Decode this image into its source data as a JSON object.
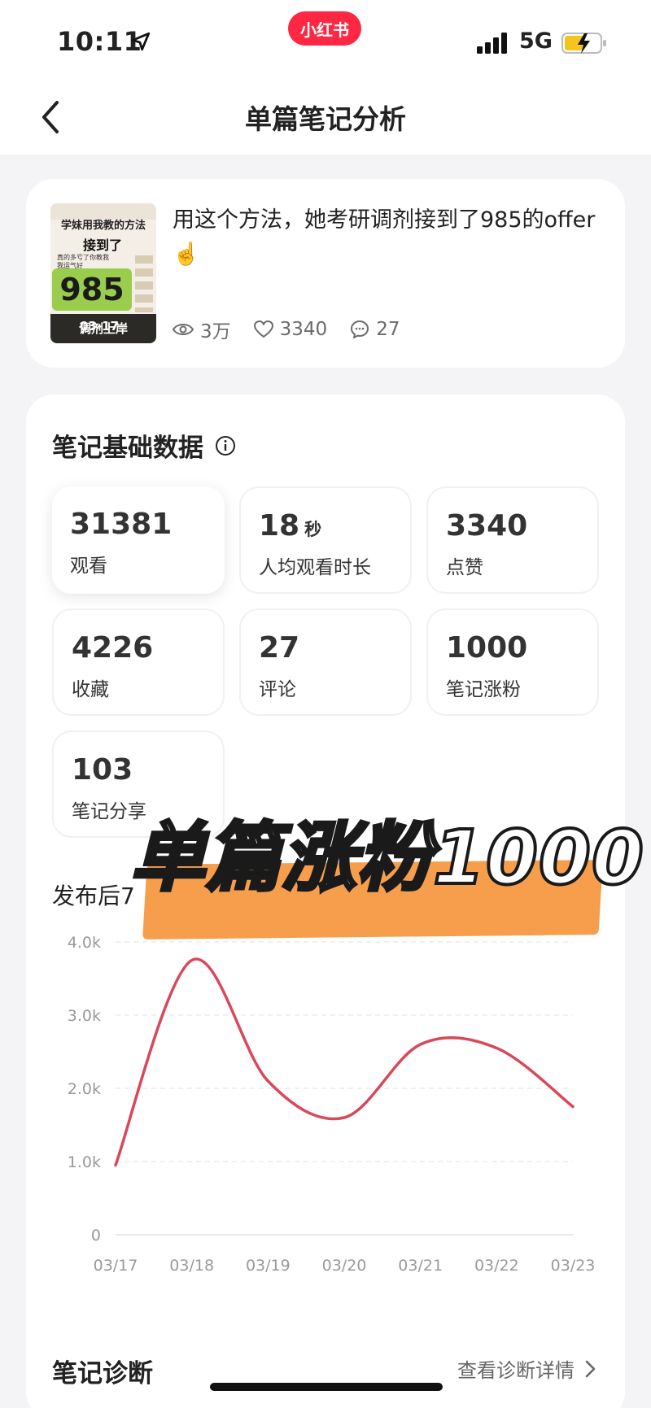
{
  "status": {
    "time": "10:11",
    "network": "5G",
    "brand": "小红书"
  },
  "nav": {
    "title": "单篇笔记分析"
  },
  "note": {
    "title": "用这个方法，她考研调剂接到了985的offer☝️",
    "views": "3万",
    "likes": "3340",
    "comments": "27",
    "thumbnail": {
      "title_line1": "学妹用我教的方法",
      "title_line2": "接到了",
      "big_text": "985",
      "small_text": "真的多亏了你教我 我运气好",
      "bottom_text": "调剂上岸",
      "timestamp": "03-17"
    }
  },
  "basic_data": {
    "title": "笔记基础数据",
    "metrics": [
      {
        "value": "31381",
        "unit": "",
        "label": "观看"
      },
      {
        "value": "18",
        "unit": "秒",
        "label": "人均观看时长"
      },
      {
        "value": "3340",
        "unit": "",
        "label": "点赞"
      },
      {
        "value": "4226",
        "unit": "",
        "label": "收藏"
      },
      {
        "value": "27",
        "unit": "",
        "label": "评论"
      },
      {
        "value": "1000",
        "unit": "",
        "label": "笔记涨粉"
      },
      {
        "value": "103",
        "unit": "",
        "label": "笔记分享"
      }
    ]
  },
  "chart_section": {
    "title": "发布后7"
  },
  "chart_data": {
    "type": "line",
    "categories": [
      "03/17",
      "03/18",
      "03/19",
      "03/20",
      "03/21",
      "03/22",
      "03/23"
    ],
    "series": [
      {
        "values": [
          950,
          3750,
          2100,
          1600,
          2600,
          2550,
          1750
        ]
      }
    ],
    "y_ticks": [
      "0",
      "1.0k",
      "2.0k",
      "3.0k",
      "4.0k"
    ],
    "ylim": [
      0,
      4000
    ],
    "grid": true,
    "color": "#d9485a"
  },
  "diagnosis": {
    "title": "笔记诊断",
    "link": "查看诊断详情"
  },
  "overlay": {
    "text": "单篇涨粉1000"
  }
}
